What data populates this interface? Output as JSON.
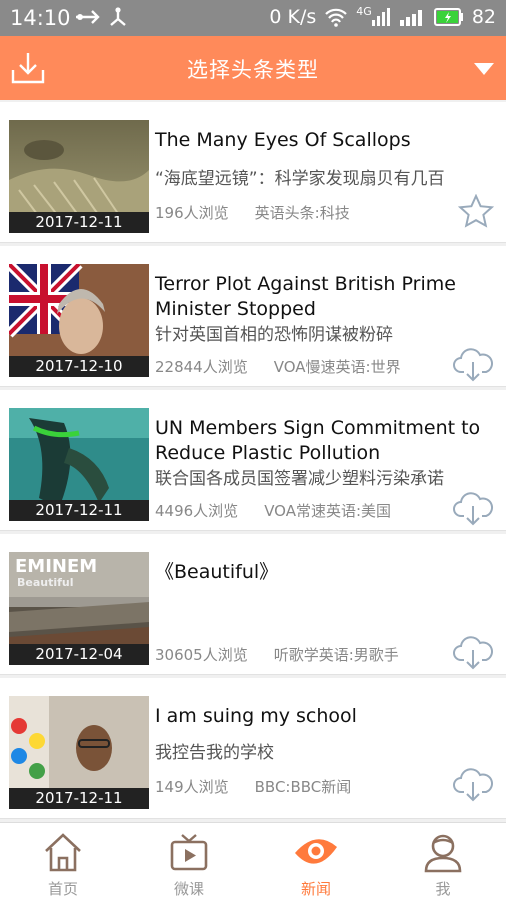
{
  "status_bar": {
    "time": "14:10",
    "data_speed": "0 K/s",
    "network": "4G",
    "battery": "82"
  },
  "header": {
    "title": "选择头条类型"
  },
  "articles": [
    {
      "date": "2017-12-11",
      "title_en": "The Many Eyes Of Scallops",
      "title_cn": "“海底望远镜”：科学家发现扇贝有几百",
      "views": "196人浏览",
      "category": "英语头条:科技",
      "action": "star-icon"
    },
    {
      "date": "2017-12-10",
      "title_en": "Terror Plot Against British Prime Minister Stopped",
      "title_cn": "针对英国首相的恐怖阴谋被粉碎",
      "views": "22844人浏览",
      "category": "VOA慢速英语:世界",
      "action": "cloud-download-icon"
    },
    {
      "date": "2017-12-11",
      "title_en": "UN Members Sign Commitment to Reduce Plastic Pollution",
      "title_cn": "联合国各成员国签署减少塑料污染承诺",
      "views": "4496人浏览",
      "category": "VOA常速英语:美国",
      "action": "cloud-download-icon"
    },
    {
      "date": "2017-12-04",
      "title_en": "《Beautiful》",
      "title_cn": "",
      "views": "30605人浏览",
      "category": "听歌学英语:男歌手",
      "action": "cloud-download-icon",
      "thumb_text": "EMINEM",
      "thumb_sub": "Beautiful"
    },
    {
      "date": "2017-12-11",
      "title_en": "I am suing my school",
      "title_cn": "我控告我的学校",
      "views": "149人浏览",
      "category": "BBC:BBC新闻",
      "action": "cloud-download-icon"
    }
  ],
  "tabs": [
    {
      "label": "首页",
      "icon": "home-icon"
    },
    {
      "label": "微课",
      "icon": "tv-icon"
    },
    {
      "label": "新闻",
      "icon": "eye-icon",
      "active": true
    },
    {
      "label": "我",
      "icon": "user-icon"
    }
  ],
  "colors": {
    "accent": "#ff8a5a",
    "active_tab": "#ff7a3c",
    "status_bar": "#8a8a8a"
  }
}
